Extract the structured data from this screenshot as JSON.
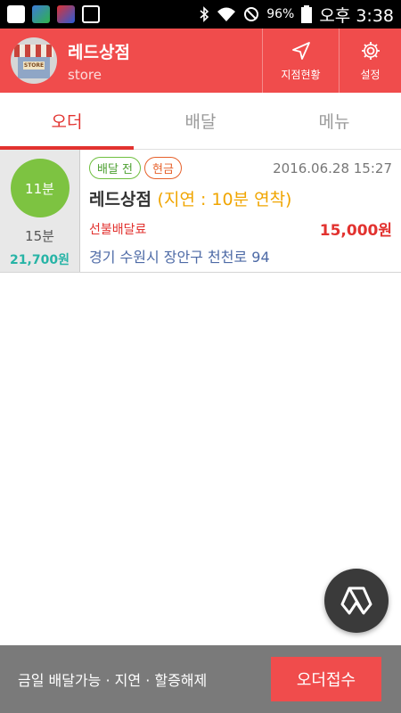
{
  "status_bar": {
    "battery": "96%",
    "time": "오후 3:38",
    "icons": [
      "notification-icon",
      "app-icon-1",
      "app-icon-2",
      "gallery-icon",
      "bluetooth-icon",
      "wifi-icon",
      "blocked-icon",
      "battery-icon"
    ]
  },
  "header": {
    "store_name": "레드상점",
    "store_sub": "store",
    "avatar_sign": "STORE",
    "branch_label": "지점현황",
    "settings_label": "설정"
  },
  "tabs": [
    {
      "label": "오더",
      "active": true
    },
    {
      "label": "배달",
      "active": false
    },
    {
      "label": "메뉴",
      "active": false
    }
  ],
  "order": {
    "elapsed": "11분",
    "eta": "15분",
    "left_price": "21,700원",
    "status_badge": "배달 전",
    "payment_badge": "현금",
    "timestamp": "2016.06.28 15:27",
    "store": "레드상점",
    "delay_note": "(지연 : 10분 연착)",
    "fee_label": "선불배달료",
    "amount": "15,000원",
    "address": "경기 수원시 장안구 천천로 94"
  },
  "bottom": {
    "status_text": "금일 배달가능 · 지연 · 할증해제",
    "accept_label": "오더접수"
  },
  "colors": {
    "brand": "#f04c4c",
    "accent_red": "#e2322f",
    "green": "#7dc341",
    "teal": "#27b4a6",
    "delay_orange": "#f0a500",
    "address_blue": "#4d6aa6",
    "bottom_gray": "#7a7a7a"
  }
}
